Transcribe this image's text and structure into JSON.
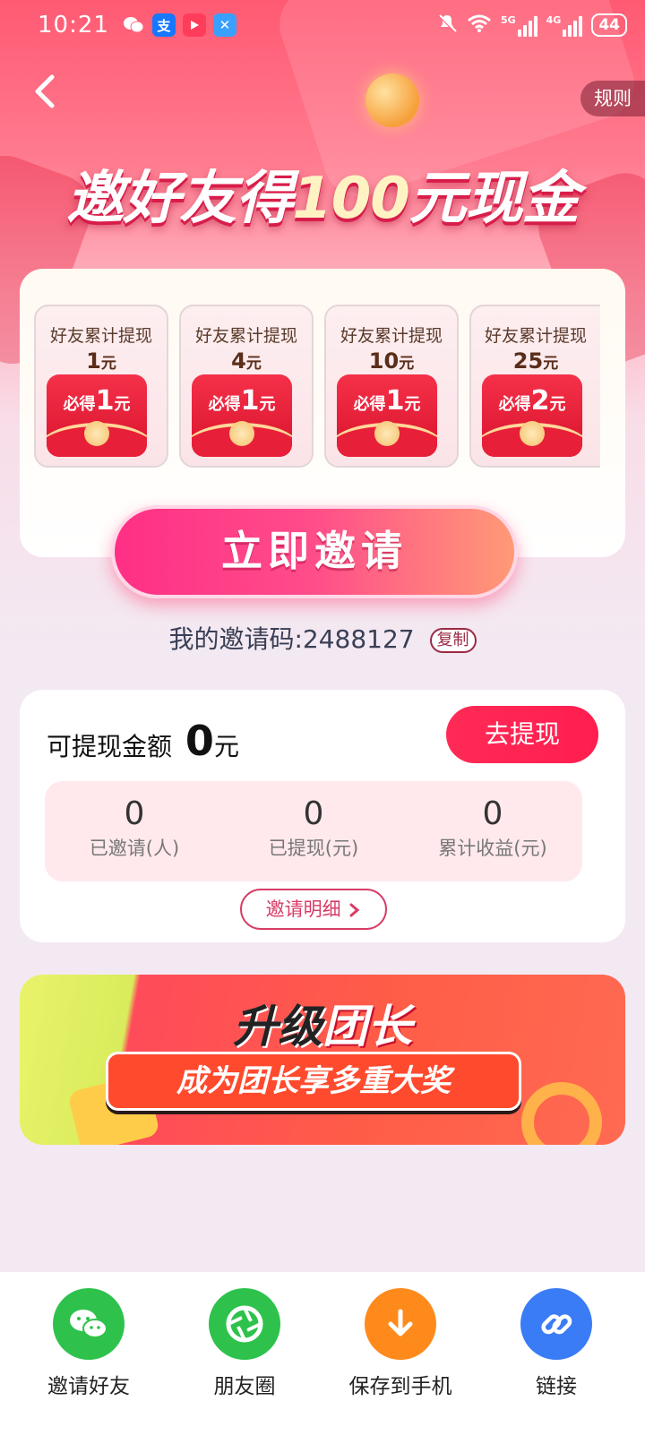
{
  "status_bar": {
    "time": "10:21",
    "network_1": "5G",
    "network_2": "4G",
    "battery": "44"
  },
  "header": {
    "back_icon": "back-arrow-icon",
    "rules_label": "规则"
  },
  "hero": {
    "title_part1": "邀好友得",
    "title_amount": "100",
    "title_part2": "元现金"
  },
  "reward_tiers": [
    {
      "label": "好友累计提现",
      "amount": "1",
      "unit": "元",
      "reward_prefix": "必得",
      "reward": "1",
      "reward_unit": "元"
    },
    {
      "label": "好友累计提现",
      "amount": "4",
      "unit": "元",
      "reward_prefix": "必得",
      "reward": "1",
      "reward_unit": "元"
    },
    {
      "label": "好友累计提现",
      "amount": "10",
      "unit": "元",
      "reward_prefix": "必得",
      "reward": "1",
      "reward_unit": "元"
    },
    {
      "label": "好友累计提现",
      "amount": "25",
      "unit": "元",
      "reward_prefix": "必得",
      "reward": "2",
      "reward_unit": "元"
    }
  ],
  "invite": {
    "button_label": "立即邀请",
    "code_label": "我的邀请码:",
    "code": "2488127",
    "copy_label": "复制"
  },
  "balance": {
    "label": "可提现金额",
    "amount": "0",
    "unit": "元",
    "withdraw_label": "去提现",
    "stats": [
      {
        "value": "0",
        "label": "已邀请(人)"
      },
      {
        "value": "0",
        "label": "已提现(元)"
      },
      {
        "value": "0",
        "label": "累计收益(元)"
      }
    ],
    "detail_label": "邀请明细"
  },
  "banner": {
    "title_part1": "升级",
    "title_part2": "团长",
    "subtitle": "成为团长享多重大奖"
  },
  "share": {
    "items": [
      {
        "label": "邀请好友",
        "icon": "wechat-icon",
        "color": "#2ec24c"
      },
      {
        "label": "朋友圈",
        "icon": "moments-icon",
        "color": "#2ec24c"
      },
      {
        "label": "保存到手机",
        "icon": "download-icon",
        "color": "#ff8a1c"
      },
      {
        "label": "链接",
        "icon": "link-icon",
        "color": "#3a7cf5"
      }
    ]
  },
  "colors": {
    "primary": "#ff2a56",
    "hero_top": "#ff5a73",
    "page_bg": "#f3e9f2"
  }
}
